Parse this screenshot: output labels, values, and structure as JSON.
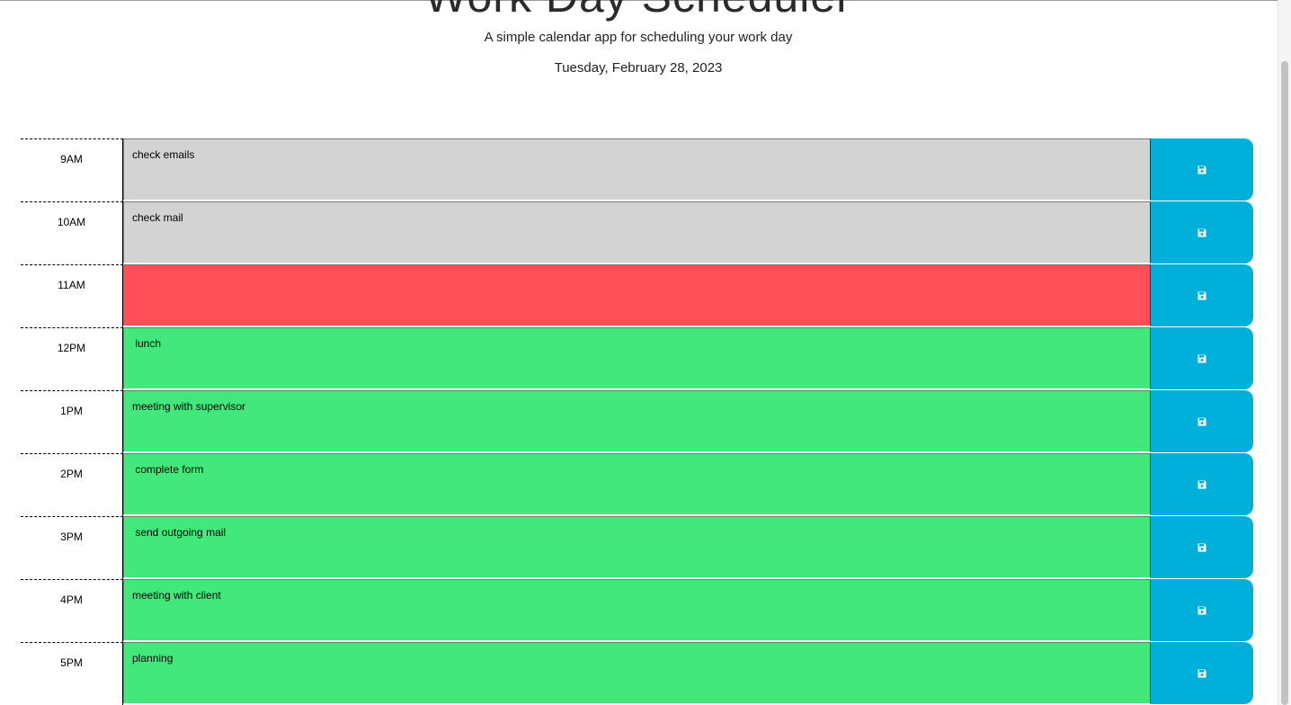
{
  "header": {
    "title": "Work Day Scheduler",
    "subtitle": "A simple calendar app for scheduling your work day",
    "date": "Tuesday, February 28, 2023"
  },
  "colors": {
    "past": "#d3d3d3",
    "present": "#ff505a",
    "future": "#42e87b",
    "save_button": "#00b0db"
  },
  "save_icon": "floppy-disk-icon",
  "blocks": [
    {
      "hour": "9AM",
      "text": "check emails",
      "state": "past"
    },
    {
      "hour": "10AM",
      "text": "check mail",
      "state": "past"
    },
    {
      "hour": "11AM",
      "text": "",
      "state": "present"
    },
    {
      "hour": "12PM",
      "text": " lunch",
      "state": "future"
    },
    {
      "hour": "1PM",
      "text": "meeting with supervisor",
      "state": "future"
    },
    {
      "hour": "2PM",
      "text": " complete form",
      "state": "future"
    },
    {
      "hour": "3PM",
      "text": " send outgoing mail",
      "state": "future"
    },
    {
      "hour": "4PM",
      "text": "meeting with client",
      "state": "future"
    },
    {
      "hour": "5PM",
      "text": "planning",
      "state": "future"
    }
  ]
}
